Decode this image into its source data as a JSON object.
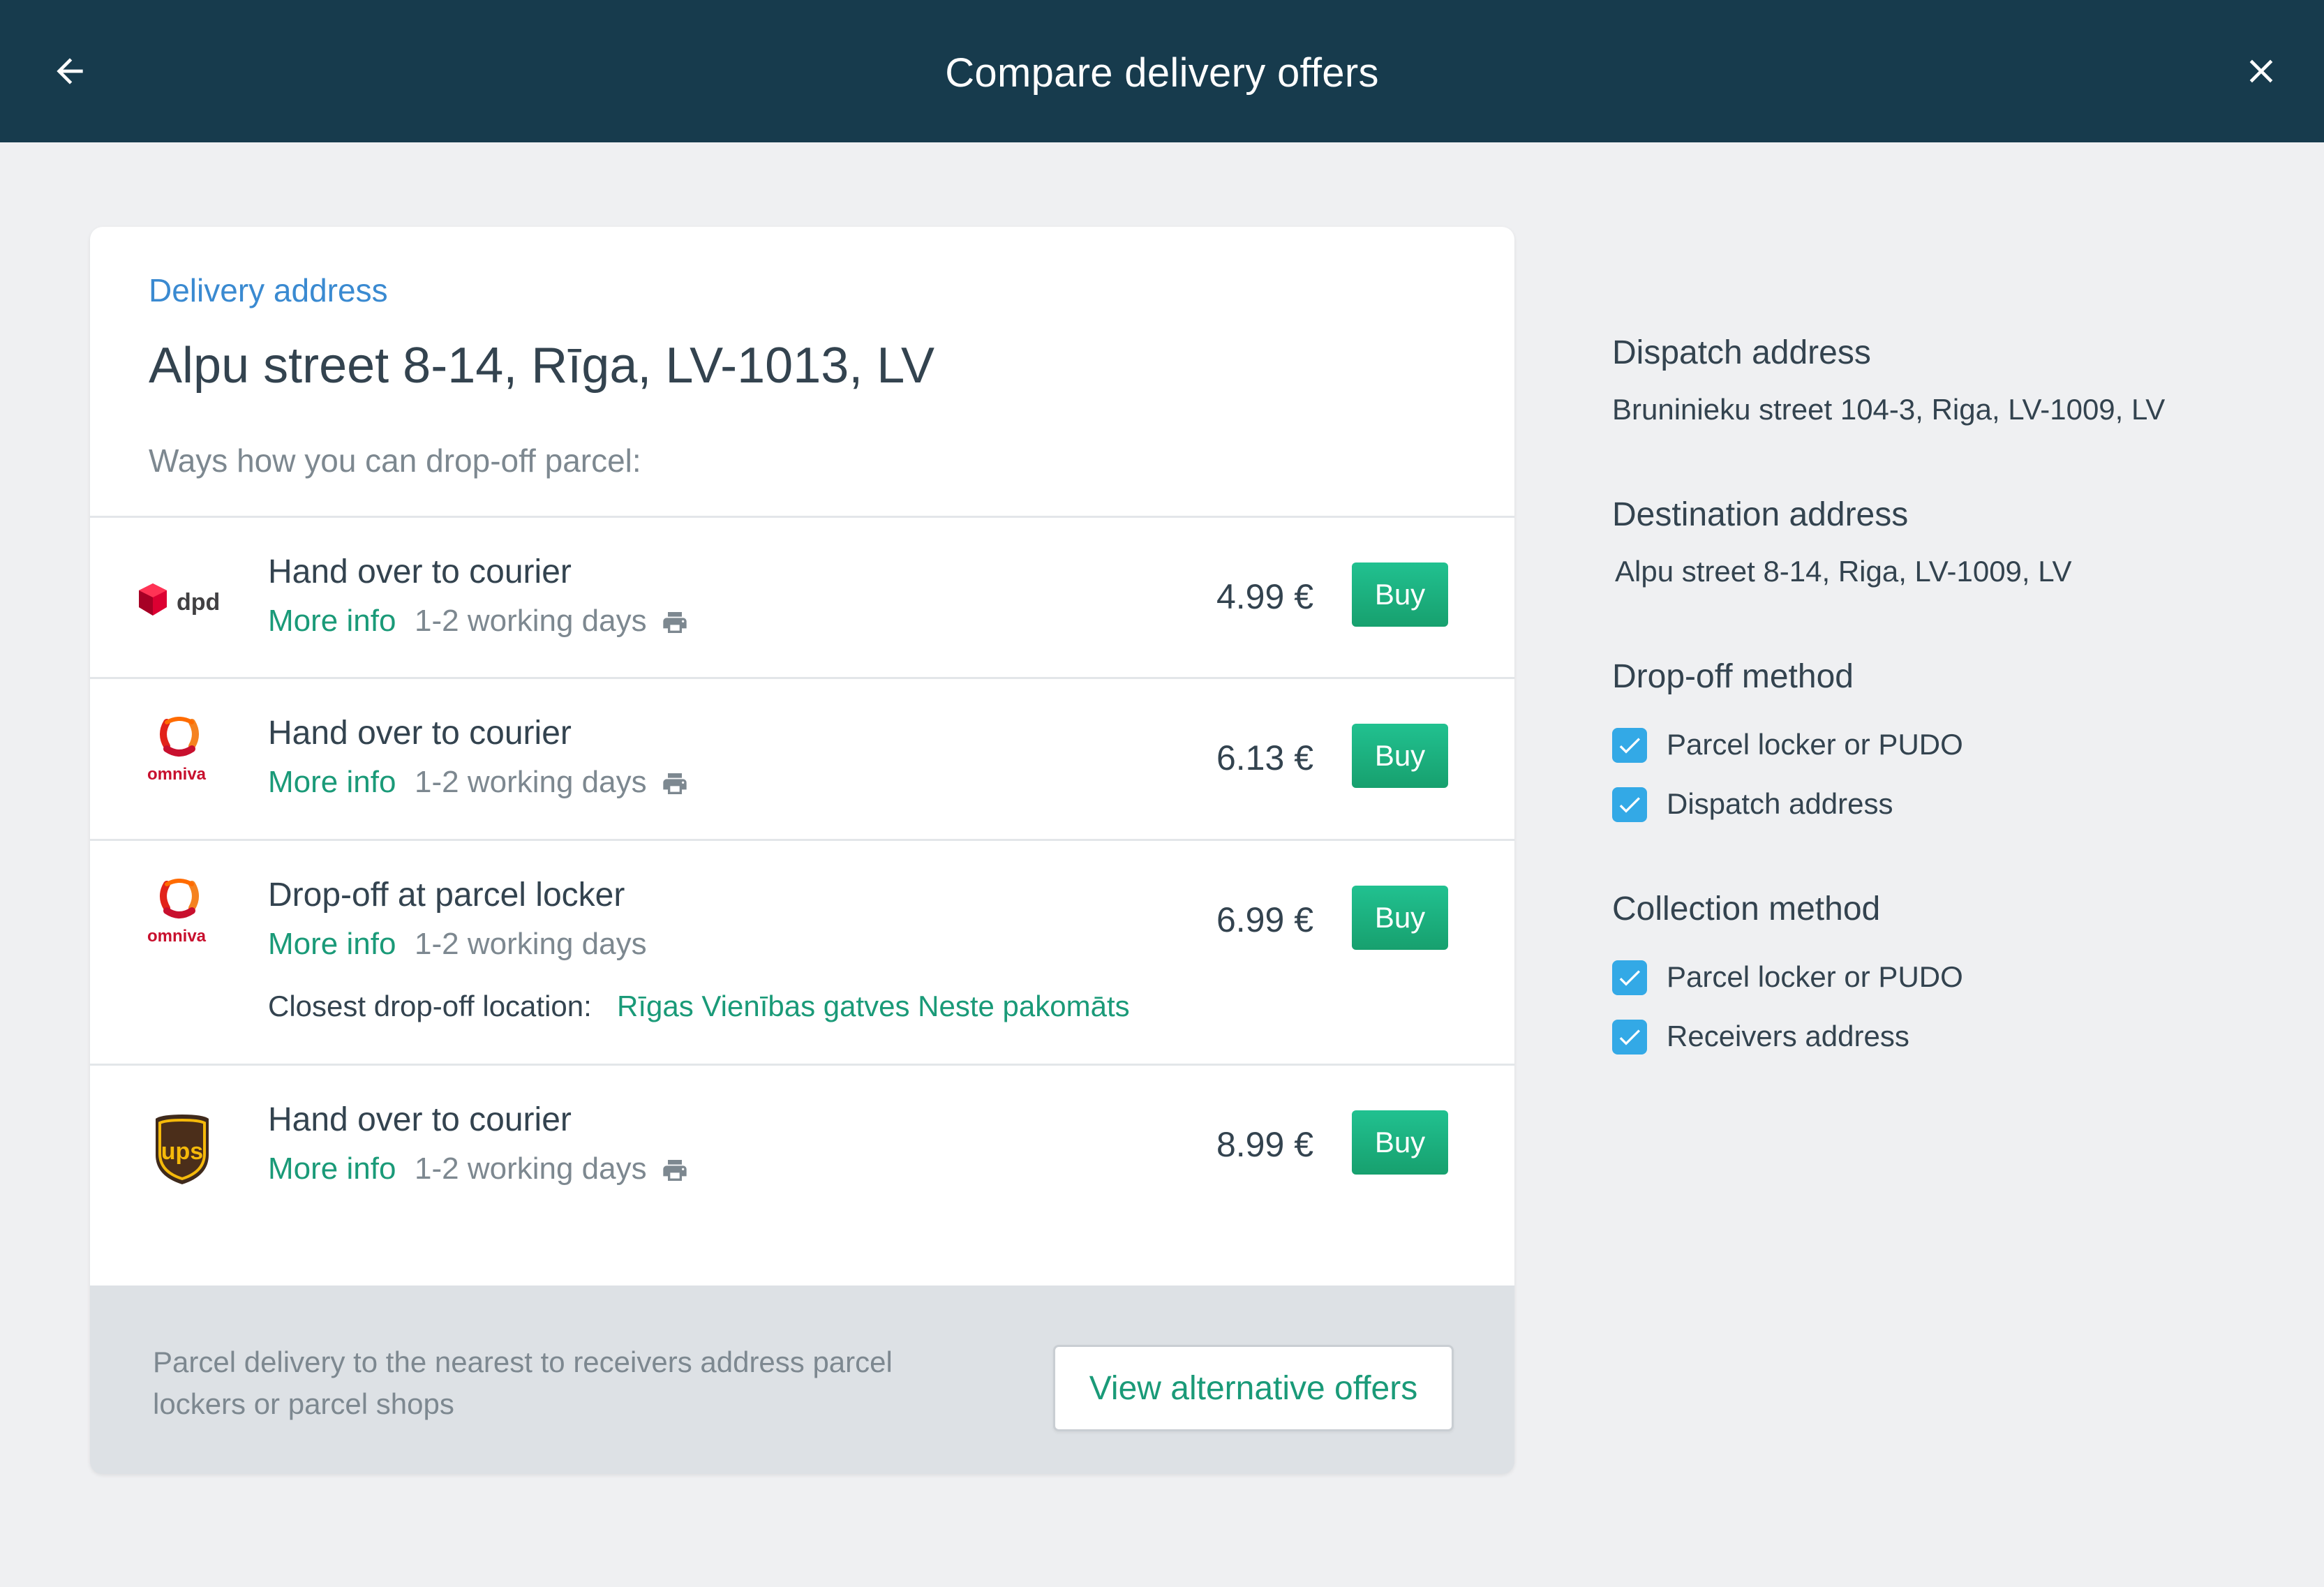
{
  "header": {
    "title": "Compare delivery offers",
    "back_icon": "arrow-left-icon",
    "close_icon": "close-icon"
  },
  "delivery": {
    "label": "Delivery address",
    "address": "Alpu street 8-14, Rīga, LV-1013, LV",
    "ways_label": "Ways how you can drop-off parcel:"
  },
  "offers": [
    {
      "carrier": "dpd",
      "method": "Hand over to courier",
      "more_info": "More info",
      "days": "1-2 working days",
      "printer": true,
      "price": "4.99  €",
      "buy": "Buy"
    },
    {
      "carrier": "omniva",
      "method": "Hand over to courier",
      "more_info": "More info",
      "days": "1-2 working days",
      "printer": true,
      "price": "6.13 €",
      "buy": "Buy"
    },
    {
      "carrier": "omniva",
      "method": "Drop-off at parcel locker",
      "more_info": "More info",
      "days": "1-2 working days",
      "printer": false,
      "price": "6.99 €",
      "buy": "Buy",
      "closest_label": "Closest drop-off location:",
      "closest_value": "Rīgas Vienības gatves Neste pakomāts"
    },
    {
      "carrier": "ups",
      "method": "Hand over to courier",
      "more_info": "More info",
      "days": "1-2 working days",
      "printer": true,
      "price": "8.99 €",
      "buy": "Buy"
    }
  ],
  "footer": {
    "text": "Parcel delivery to the nearest to receivers address parcel lockers or parcel shops",
    "button": "View alternative offers"
  },
  "logos": {
    "dpd": "dpd",
    "omniva": "omniva",
    "ups": "ups"
  },
  "side": {
    "dispatch_title": "Dispatch address",
    "dispatch_value": "Bruninieku street 104-3, Riga, LV-1009, LV",
    "destination_title": "Destination address",
    "destination_value": "Alpu street 8-14, Riga, LV-1009, LV",
    "dropoff_title": "Drop-off method",
    "dropoff_options": [
      {
        "label": "Parcel locker or PUDO",
        "checked": true
      },
      {
        "label": "Dispatch address",
        "checked": true
      }
    ],
    "collection_title": "Collection method",
    "collection_options": [
      {
        "label": "Parcel locker or PUDO",
        "checked": true
      },
      {
        "label": "Receivers address",
        "checked": true
      }
    ]
  },
  "colors": {
    "header_bg": "#173b4d",
    "accent_green": "#1a9a78",
    "link_blue": "#3a8ad1",
    "checkbox_blue": "#33a9e6"
  }
}
